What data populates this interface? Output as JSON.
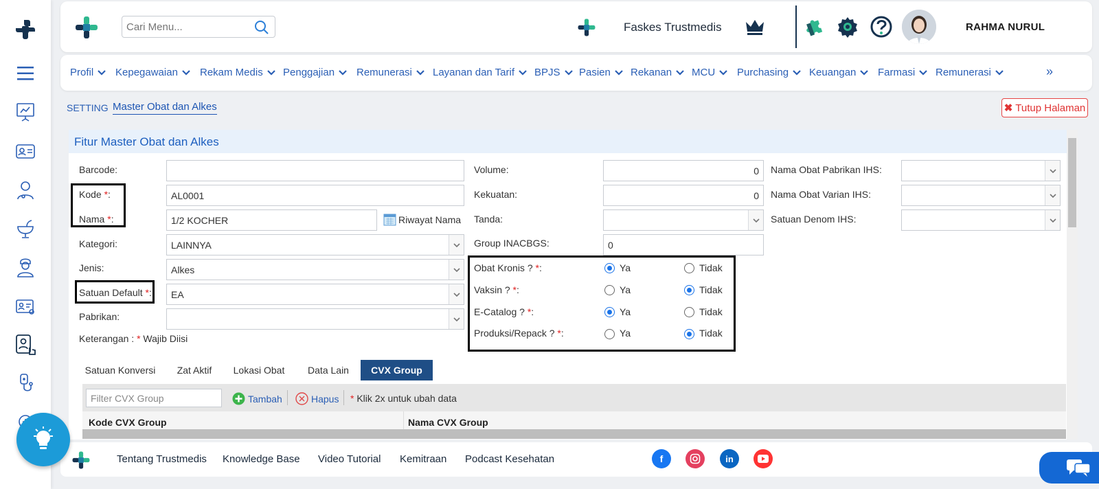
{
  "brand": {
    "logo_icon": "trustmedis-cross-logo",
    "accent": "#2b5fb5",
    "dark": "#16324f",
    "green": "#2fb88f"
  },
  "header": {
    "search_placeholder": "Cari Menu...",
    "facility_name": "Faskes Trustmedis",
    "user_name": "RAHMA NURUL"
  },
  "menu": [
    "Profil",
    "Kepegawaian",
    "Rekam Medis",
    "Penggajian",
    "Remunerasi",
    "Layanan dan Tarif",
    "BPJS",
    "Pasien",
    "Rekanan",
    "MCU",
    "Purchasing",
    "Keuangan",
    "Farmasi",
    "Remunerasi"
  ],
  "menu_more": "»",
  "breadcrumb": {
    "section": "SETTING",
    "page": "Master Obat dan Alkes"
  },
  "close_page_label": "Tutup Halaman",
  "panel_title": "Fitur Master Obat dan Alkes",
  "form": {
    "barcode": {
      "label": "Barcode:",
      "value": ""
    },
    "kode": {
      "label": "Kode ",
      "value": "AL0001"
    },
    "nama": {
      "label": "Nama ",
      "value": "1/2 KOCHER",
      "history_label": "Riwayat Nama"
    },
    "kategori": {
      "label": "Kategori:",
      "value": "LAINNYA"
    },
    "jenis": {
      "label": "Jenis:",
      "value": "Alkes"
    },
    "satuan_default": {
      "label": "Satuan Default ",
      "value": "EA"
    },
    "pabrikan": {
      "label": "Pabrikan:",
      "value": ""
    },
    "required_star": "*",
    "required_suffix": ":",
    "keterangan": {
      "prefix": "Keterangan : ",
      "star": "*",
      "text": " Wajib Diisi"
    },
    "volume": {
      "label": "Volume:",
      "value": "0"
    },
    "kekuatan": {
      "label": "Kekuatan:",
      "value": "0"
    },
    "tanda": {
      "label": "Tanda:",
      "value": ""
    },
    "group_inacbgs": {
      "label": "Group INACBGS:",
      "value": "0"
    },
    "nama_pabrikan_ihs": {
      "label": "Nama Obat Pabrikan IHS:",
      "value": ""
    },
    "nama_varian_ihs": {
      "label": "Nama Obat Varian IHS:",
      "value": ""
    },
    "satuan_denom_ihs": {
      "label": "Satuan Denom IHS:",
      "value": ""
    }
  },
  "radios": {
    "yes_label": "Ya",
    "no_label": "Tidak",
    "items": [
      {
        "label": "Obat Kronis ? ",
        "selected": "Ya"
      },
      {
        "label": "Vaksin ? ",
        "selected": "Tidak"
      },
      {
        "label": "E-Catalog ? ",
        "selected": "Ya"
      },
      {
        "label": "Produksi/Repack ? ",
        "selected": "Tidak"
      }
    ]
  },
  "tabs": [
    "Satuan Konversi",
    "Zat Aktif",
    "Lokasi Obat",
    "Data Lain",
    "CVX Group"
  ],
  "active_tab": "CVX Group",
  "grid": {
    "filter_placeholder": "Filter CVX Group",
    "add_label": "Tambah",
    "delete_label": "Hapus",
    "hint_star": "*",
    "hint": " Klik 2x untuk ubah data",
    "columns": [
      "Kode CVX Group",
      "Nama CVX Group"
    ]
  },
  "footer": {
    "links": [
      "Tentang Trustmedis",
      "Knowledge Base",
      "Video Tutorial",
      "Kemitraan",
      "Podcast Kesehatan"
    ],
    "social_icons": [
      "facebook-icon",
      "instagram-icon",
      "linkedin-icon",
      "youtube-icon"
    ]
  }
}
